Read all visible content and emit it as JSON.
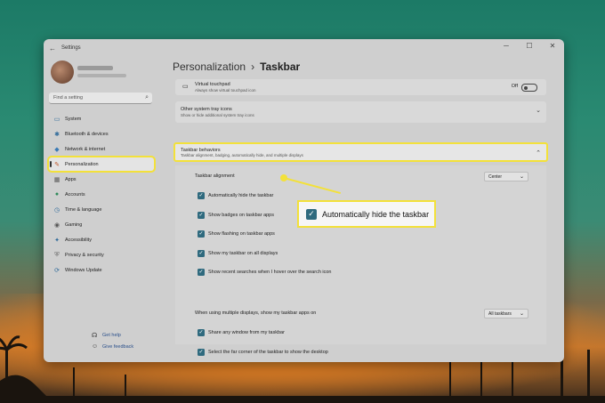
{
  "window": {
    "title": "Settings",
    "back_icon": "back-arrow-icon",
    "controls": {
      "minimize": "─",
      "maximize": "☐",
      "close": "✕"
    }
  },
  "sidebar": {
    "search_placeholder": "Find a setting",
    "items": [
      {
        "label": "System",
        "icon": "▭",
        "color": "#2f6a9a"
      },
      {
        "label": "Bluetooth & devices",
        "icon": "✱",
        "color": "#2f6a9a"
      },
      {
        "label": "Network & internet",
        "icon": "◆",
        "color": "#3a7ab5"
      },
      {
        "label": "Personalization",
        "icon": "✎",
        "color": "#c0552a",
        "active": true
      },
      {
        "label": "Apps",
        "icon": "▦",
        "color": "#555"
      },
      {
        "label": "Accounts",
        "icon": "●",
        "color": "#2f8a5a"
      },
      {
        "label": "Time & language",
        "icon": "◷",
        "color": "#2f6a9a"
      },
      {
        "label": "Gaming",
        "icon": "◉",
        "color": "#555"
      },
      {
        "label": "Accessibility",
        "icon": "✦",
        "color": "#2f6a9a"
      },
      {
        "label": "Privacy & security",
        "icon": "⛨",
        "color": "#666"
      },
      {
        "label": "Windows Update",
        "icon": "⟳",
        "color": "#2f6a9a"
      }
    ]
  },
  "breadcrumb": {
    "parent": "Personalization",
    "separator": "›",
    "current": "Taskbar"
  },
  "touchpad": {
    "title": "Virtual touchpad",
    "subtitle": "Always show virtual touchpad icon",
    "state": "Off"
  },
  "tray": {
    "title": "Other system tray icons",
    "subtitle": "Show or hide additional system tray icons"
  },
  "behaviors": {
    "title": "Taskbar behaviors",
    "subtitle": "Taskbar alignment, badging, automatically hide, and multiple displays",
    "alignment_label": "Taskbar alignment",
    "alignment_value": "Center",
    "options": [
      "Automatically hide the taskbar",
      "Show badges on taskbar apps",
      "Show flashing on taskbar apps",
      "Show my taskbar on all displays",
      "Show recent searches when I hover over the search icon"
    ],
    "multi_display_label": "When using multiple displays, show my taskbar apps on",
    "multi_display_value": "All taskbars",
    "options2": [
      "Share any window from my taskbar",
      "Select the far corner of the taskbar to show the desktop"
    ]
  },
  "callout": {
    "label": "Automatically hide the taskbar"
  },
  "footer": {
    "help": "Get help",
    "feedback": "Give feedback"
  },
  "colors": {
    "highlight": "#f3e13a",
    "checkbox": "#2f6a7e"
  }
}
